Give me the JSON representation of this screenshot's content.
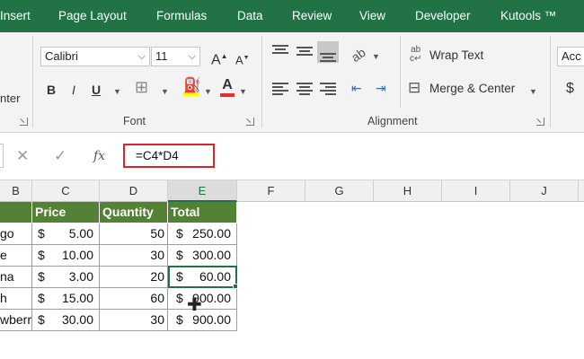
{
  "tabs": [
    "Insert",
    "Page Layout",
    "Formulas",
    "Data",
    "Review",
    "View",
    "Developer",
    "Kutools ™"
  ],
  "ribbon": {
    "partial_label": "nter",
    "font": {
      "name": "Calibri",
      "size": "11",
      "grow_label": "A",
      "shrink_label": "A",
      "bold": "B",
      "italic": "I",
      "underline": "U",
      "font_color": "A",
      "group_label": "Font"
    },
    "alignment": {
      "wrap_text": "Wrap Text",
      "merge_center": "Merge & Center",
      "group_label": "Alignment"
    },
    "number": {
      "format_value": "Acc",
      "currency_symbol": "$"
    }
  },
  "formula_bar": {
    "cancel_icon": "✕",
    "enter_icon": "✓",
    "fx_label": "fx",
    "formula": "=C4*D4"
  },
  "columns": [
    "B",
    "C",
    "D",
    "E",
    "F",
    "G",
    "H",
    "I",
    "J"
  ],
  "selected_column": "E",
  "table": {
    "headers": [
      "Price",
      "Quantity",
      "Total"
    ],
    "rows": [
      {
        "item": "go",
        "price_sym": "$",
        "price": "5.00",
        "qty": "50",
        "total_sym": "$",
        "total": "250.00"
      },
      {
        "item": "e",
        "price_sym": "$",
        "price": "10.00",
        "qty": "30",
        "total_sym": "$",
        "total": "300.00"
      },
      {
        "item": "na",
        "price_sym": "$",
        "price": "3.00",
        "qty": "20",
        "total_sym": "$",
        "total": "60.00"
      },
      {
        "item": "h",
        "price_sym": "$",
        "price": "15.00",
        "qty": "60",
        "total_sym": "$",
        "total": "900.00"
      },
      {
        "item": "wberr",
        "price_sym": "$",
        "price": "30.00",
        "qty": "30",
        "total_sym": "$",
        "total": "900.00"
      }
    ]
  },
  "colors": {
    "ribbon_tab": "#217346",
    "table_header": "#548235",
    "formula_highlight": "#d9232e",
    "selection": "#217346"
  }
}
